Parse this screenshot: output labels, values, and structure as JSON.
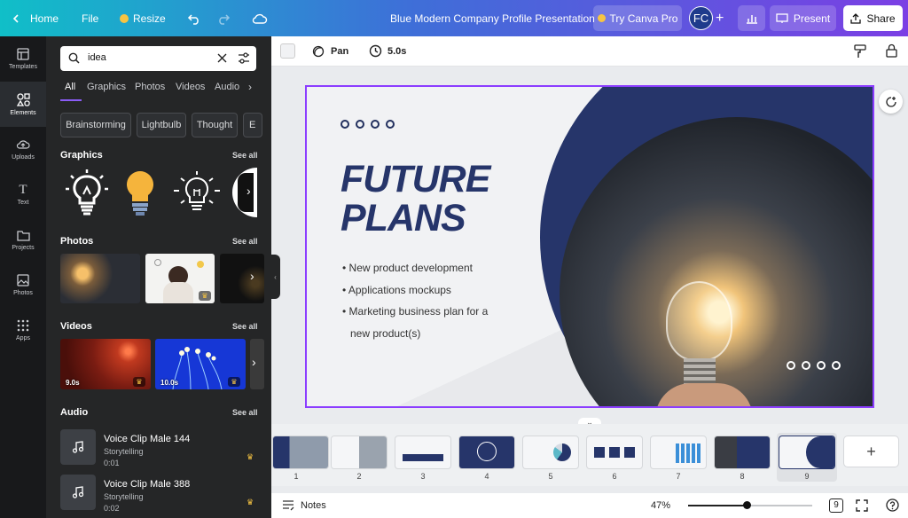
{
  "topbar": {
    "home": "Home",
    "file": "File",
    "resize": "Resize",
    "doc_title": "Blue Modern Company Profile Presentation",
    "try_pro": "Try Canva Pro",
    "avatar": "FC",
    "present": "Present",
    "share": "Share"
  },
  "rail": [
    {
      "label": "Templates",
      "icon": "templates-icon"
    },
    {
      "label": "Elements",
      "icon": "elements-icon"
    },
    {
      "label": "Uploads",
      "icon": "uploads-icon"
    },
    {
      "label": "Text",
      "icon": "text-icon"
    },
    {
      "label": "Projects",
      "icon": "projects-icon"
    },
    {
      "label": "Photos",
      "icon": "photos-icon"
    },
    {
      "label": "Apps",
      "icon": "apps-icon"
    }
  ],
  "panel": {
    "search_value": "idea",
    "tabs": [
      "All",
      "Graphics",
      "Photos",
      "Videos",
      "Audio"
    ],
    "chips": [
      "Brainstorming",
      "Lightbulb",
      "Thought",
      "E"
    ],
    "graphics_title": "Graphics",
    "photos_title": "Photos",
    "videos_title": "Videos",
    "audio_title": "Audio",
    "see_all": "See all",
    "videos": [
      {
        "duration": "9.0s"
      },
      {
        "duration": "10.0s"
      }
    ],
    "audio": [
      {
        "title": "Voice Clip Male 144",
        "artist": "Storytelling",
        "duration": "0:01"
      },
      {
        "title": "Voice Clip Male 388",
        "artist": "Storytelling",
        "duration": "0:02"
      }
    ]
  },
  "context": {
    "pan": "Pan",
    "duration": "5.0s"
  },
  "slide": {
    "title_line1": "FUTURE",
    "title_line2": "PLANS",
    "bullets": [
      "New product development",
      "Applications mockups",
      "Marketing business plan for a",
      "new product(s)"
    ]
  },
  "filmstrip": {
    "pages": [
      "1",
      "2",
      "3",
      "4",
      "5",
      "6",
      "7",
      "8",
      "9"
    ],
    "add": "+"
  },
  "bottom": {
    "notes": "Notes",
    "zoom": "47%",
    "zoom_level": 0.47,
    "page_count": "9"
  },
  "colors": {
    "accent": "#8b3dff",
    "navy": "#26356a",
    "panel_bg": "#252627"
  }
}
